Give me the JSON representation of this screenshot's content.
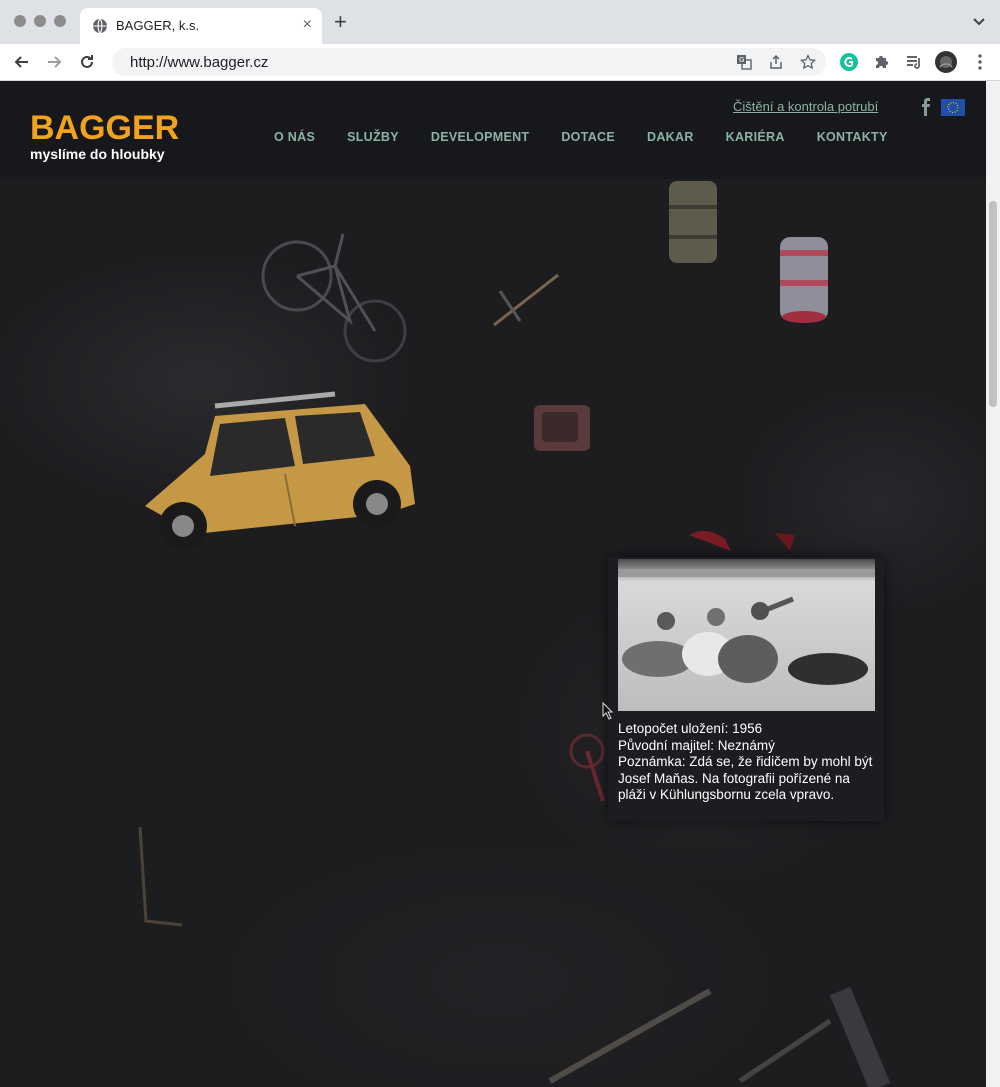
{
  "browser": {
    "tab_title": "BAGGER, k.s.",
    "url": "http://www.bagger.cz",
    "tab_close_glyph": "×",
    "new_tab_glyph": "+"
  },
  "site": {
    "logo": "BAGGER",
    "tagline": "myslíme do hloubky",
    "top_link": "Čištění a kontrola potrubí",
    "nav": [
      "O NÁS",
      "SLUŽBY",
      "DEVELOPMENT",
      "DOTACE",
      "DAKAR",
      "KARIÉRA",
      "KONTAKTY"
    ],
    "colors": {
      "accent": "#f3a21d",
      "nav": "#8db2a3",
      "background": "#1d1d20",
      "header": "#17181b"
    }
  },
  "popup": {
    "year": "Letopočet uložení: 1956",
    "owner": "Původní majitel: Neznámý",
    "note": "Poznámka: Zdá se, že řidičem by mohl být Josef Maňas. Na fotografii pořízené na pláži v Kühlungsbornu zcela vpravo."
  },
  "icons": [
    "globe-icon",
    "close-icon",
    "plus-icon",
    "chevron-down-icon",
    "back-arrow-icon",
    "forward-arrow-icon",
    "reload-icon",
    "translate-icon",
    "share-icon",
    "star-icon",
    "grammarly-icon",
    "puzzle-icon",
    "media-queue-icon",
    "avatar",
    "kebab-menu-icon",
    "facebook-icon",
    "eu-flag-icon",
    "cursor-icon"
  ]
}
